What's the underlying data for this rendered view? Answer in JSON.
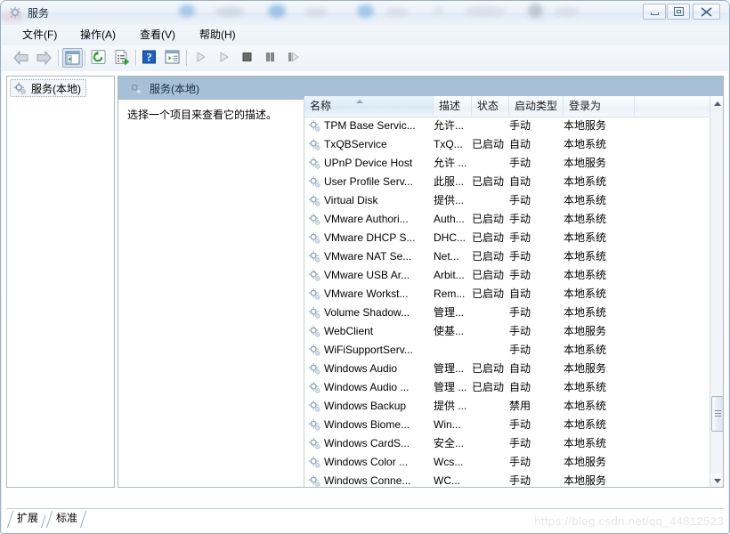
{
  "window": {
    "title": "服务",
    "icon": "services-gear-icon",
    "controls": {
      "minimize": "最小化",
      "maximize": "最大化",
      "close": "关闭"
    }
  },
  "menubar": {
    "items": [
      {
        "label": "文件(F)",
        "name": "menu-file"
      },
      {
        "label": "操作(A)",
        "name": "menu-action"
      },
      {
        "label": "查看(V)",
        "name": "menu-view"
      },
      {
        "label": "帮助(H)",
        "name": "menu-help"
      }
    ]
  },
  "toolbar": {
    "items": [
      {
        "name": "back-icon",
        "tip": "后退"
      },
      {
        "name": "forward-icon",
        "tip": "前进"
      },
      {
        "name": "show-tree-icon",
        "tip": "显示/隐藏控制台树"
      },
      {
        "name": "refresh-icon",
        "tip": "刷新"
      },
      {
        "name": "export-list-icon",
        "tip": "导出列表"
      },
      {
        "name": "help-icon",
        "tip": "帮助"
      },
      {
        "name": "properties-icon",
        "tip": "属性"
      },
      {
        "name": "start-service-icon",
        "tip": "启动服务"
      },
      {
        "name": "resume-service-icon",
        "tip": "恢复服务"
      },
      {
        "name": "stop-service-icon",
        "tip": "停止服务"
      },
      {
        "name": "pause-service-icon",
        "tip": "暂停服务"
      },
      {
        "name": "restart-service-icon",
        "tip": "重启服务"
      }
    ]
  },
  "tree": {
    "root": {
      "label": "服务(本地)",
      "icon": "services-gear-icon",
      "selected": true
    }
  },
  "detail": {
    "header": "服务(本地)",
    "header_icon": "services-gear-icon",
    "description": "选择一个项目来查看它的描述。"
  },
  "list": {
    "columns": [
      {
        "label": "名称",
        "name": "column-name",
        "sorted": true,
        "sort_dir": "asc"
      },
      {
        "label": "描述",
        "name": "column-description"
      },
      {
        "label": "状态",
        "name": "column-status"
      },
      {
        "label": "启动类型",
        "name": "column-startup-type"
      },
      {
        "label": "登录为",
        "name": "column-log-on-as"
      }
    ],
    "rows": [
      {
        "name": "TPM Base Servic...",
        "description": "允许...",
        "status": "",
        "startup": "手动",
        "logon": "本地服务"
      },
      {
        "name": "TxQBService",
        "description": "TxQ...",
        "status": "已启动",
        "startup": "自动",
        "logon": "本地系统"
      },
      {
        "name": "UPnP Device Host",
        "description": "允许 ...",
        "status": "",
        "startup": "手动",
        "logon": "本地服务"
      },
      {
        "name": "User Profile Serv...",
        "description": "此服...",
        "status": "已启动",
        "startup": "自动",
        "logon": "本地系统"
      },
      {
        "name": "Virtual Disk",
        "description": "提供...",
        "status": "",
        "startup": "手动",
        "logon": "本地系统"
      },
      {
        "name": "VMware Authori...",
        "description": "Auth...",
        "status": "已启动",
        "startup": "手动",
        "logon": "本地系统"
      },
      {
        "name": "VMware DHCP S...",
        "description": "DHC...",
        "status": "已启动",
        "startup": "手动",
        "logon": "本地系统"
      },
      {
        "name": "VMware NAT Se...",
        "description": "Net...",
        "status": "已启动",
        "startup": "手动",
        "logon": "本地系统"
      },
      {
        "name": "VMware USB Ar...",
        "description": "Arbit...",
        "status": "已启动",
        "startup": "手动",
        "logon": "本地系统"
      },
      {
        "name": "VMware Workst...",
        "description": "Rem...",
        "status": "已启动",
        "startup": "自动",
        "logon": "本地系统"
      },
      {
        "name": "Volume Shadow...",
        "description": "管理...",
        "status": "",
        "startup": "手动",
        "logon": "本地系统"
      },
      {
        "name": "WebClient",
        "description": "使基...",
        "status": "",
        "startup": "手动",
        "logon": "本地服务"
      },
      {
        "name": "WiFiSupportServ...",
        "description": "",
        "status": "",
        "startup": "手动",
        "logon": "本地系统"
      },
      {
        "name": "Windows Audio",
        "description": "管理...",
        "status": "已启动",
        "startup": "自动",
        "logon": "本地服务"
      },
      {
        "name": "Windows Audio ...",
        "description": "管理 ...",
        "status": "已启动",
        "startup": "自动",
        "logon": "本地系统"
      },
      {
        "name": "Windows Backup",
        "description": "提供 ...",
        "status": "",
        "startup": "禁用",
        "logon": "本地系统"
      },
      {
        "name": "Windows Biome...",
        "description": "Win...",
        "status": "",
        "startup": "手动",
        "logon": "本地系统"
      },
      {
        "name": "Windows CardS...",
        "description": "安全...",
        "status": "",
        "startup": "手动",
        "logon": "本地系统"
      },
      {
        "name": "Windows Color ...",
        "description": "Wcs...",
        "status": "",
        "startup": "手动",
        "logon": "本地服务"
      },
      {
        "name": "Windows Conne...",
        "description": "WC...",
        "status": "",
        "startup": "手动",
        "logon": "本地服务"
      }
    ],
    "row_icon": "service-gear-icon"
  },
  "scrollbar": {
    "up_icon": "scroll-up-arrow-icon",
    "down_icon": "scroll-down-arrow-icon",
    "thumb": "scroll-thumb"
  },
  "tabs": [
    {
      "label": "扩展",
      "name": "tab-extended",
      "active": false
    },
    {
      "label": "标准",
      "name": "tab-standard",
      "active": true
    }
  ],
  "watermark": "https://blog.csdn.net/qq_44812523",
  "colors": {
    "header_band": "#a7c0d8",
    "frame_border": "#9ab0c4",
    "sorted_column": "#dfeef8"
  }
}
